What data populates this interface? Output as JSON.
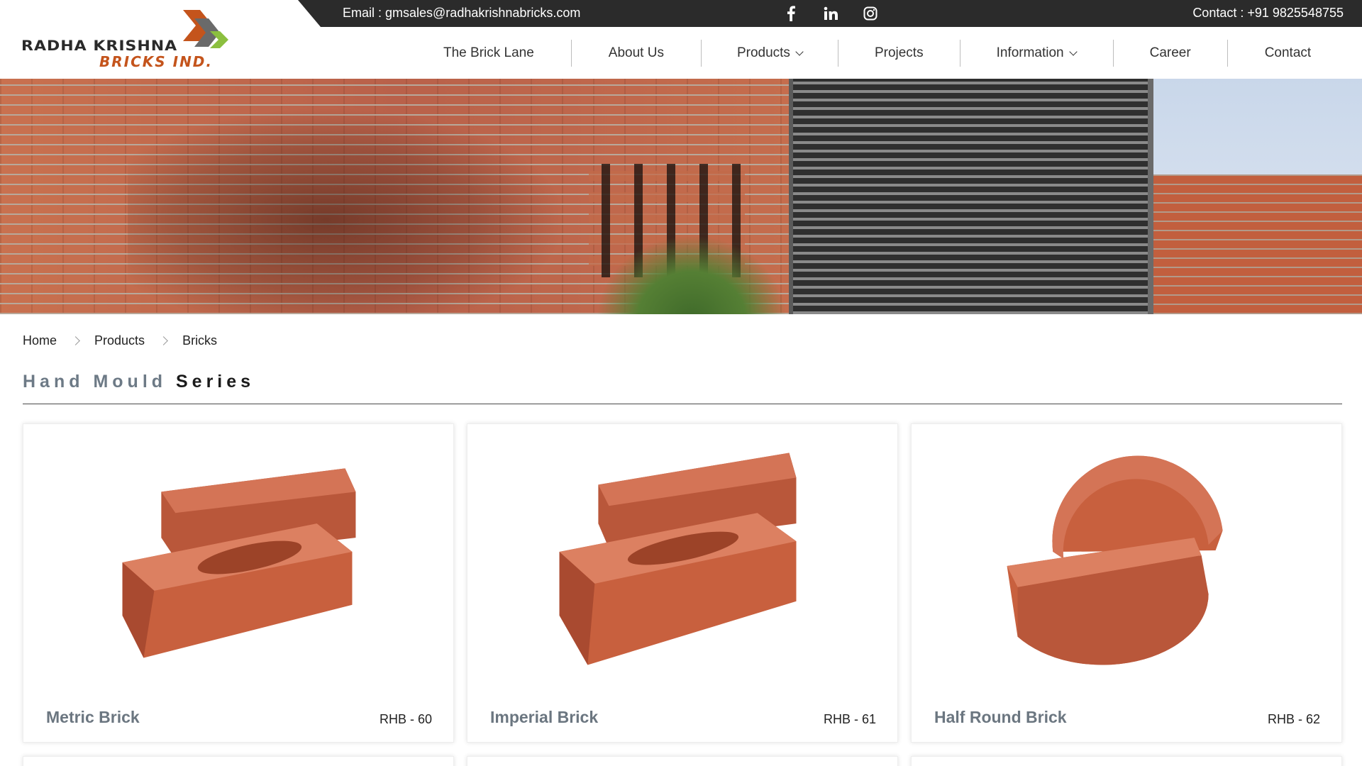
{
  "topbar": {
    "email": "Email : gmsales@radhakrishnabricks.com",
    "contact": "Contact : +91 9825548755",
    "social": [
      {
        "icon": "facebook-icon"
      },
      {
        "icon": "linkedin-icon"
      },
      {
        "icon": "instagram-icon"
      }
    ]
  },
  "logo": {
    "line1": "RADHA KRISHNA",
    "line2": "BRICKS IND."
  },
  "nav": {
    "items": [
      {
        "label": "The Brick Lane"
      },
      {
        "label": "About Us"
      },
      {
        "label": "Products",
        "has_dropdown": true
      },
      {
        "label": "Projects"
      },
      {
        "label": "Information",
        "has_dropdown": true
      },
      {
        "label": "Career"
      },
      {
        "label": "Contact"
      }
    ]
  },
  "breadcrumb": [
    "Home",
    "Products",
    "Bricks"
  ],
  "section": {
    "title_muted": "Hand Mould",
    "title_strong": "Series"
  },
  "products": [
    {
      "name": "Metric Brick",
      "code": "RHB - 60",
      "shape": "rect"
    },
    {
      "name": "Imperial Brick",
      "code": "RHB - 61",
      "shape": "rect"
    },
    {
      "name": "Half Round Brick",
      "code": "RHB - 62",
      "shape": "half-round"
    }
  ],
  "colors": {
    "topbar": "#2b2b2b",
    "brick": "#c8603e",
    "brand_orange": "#c4541c",
    "brand_green": "#8bbf3f",
    "muted_text": "#6b7680"
  }
}
